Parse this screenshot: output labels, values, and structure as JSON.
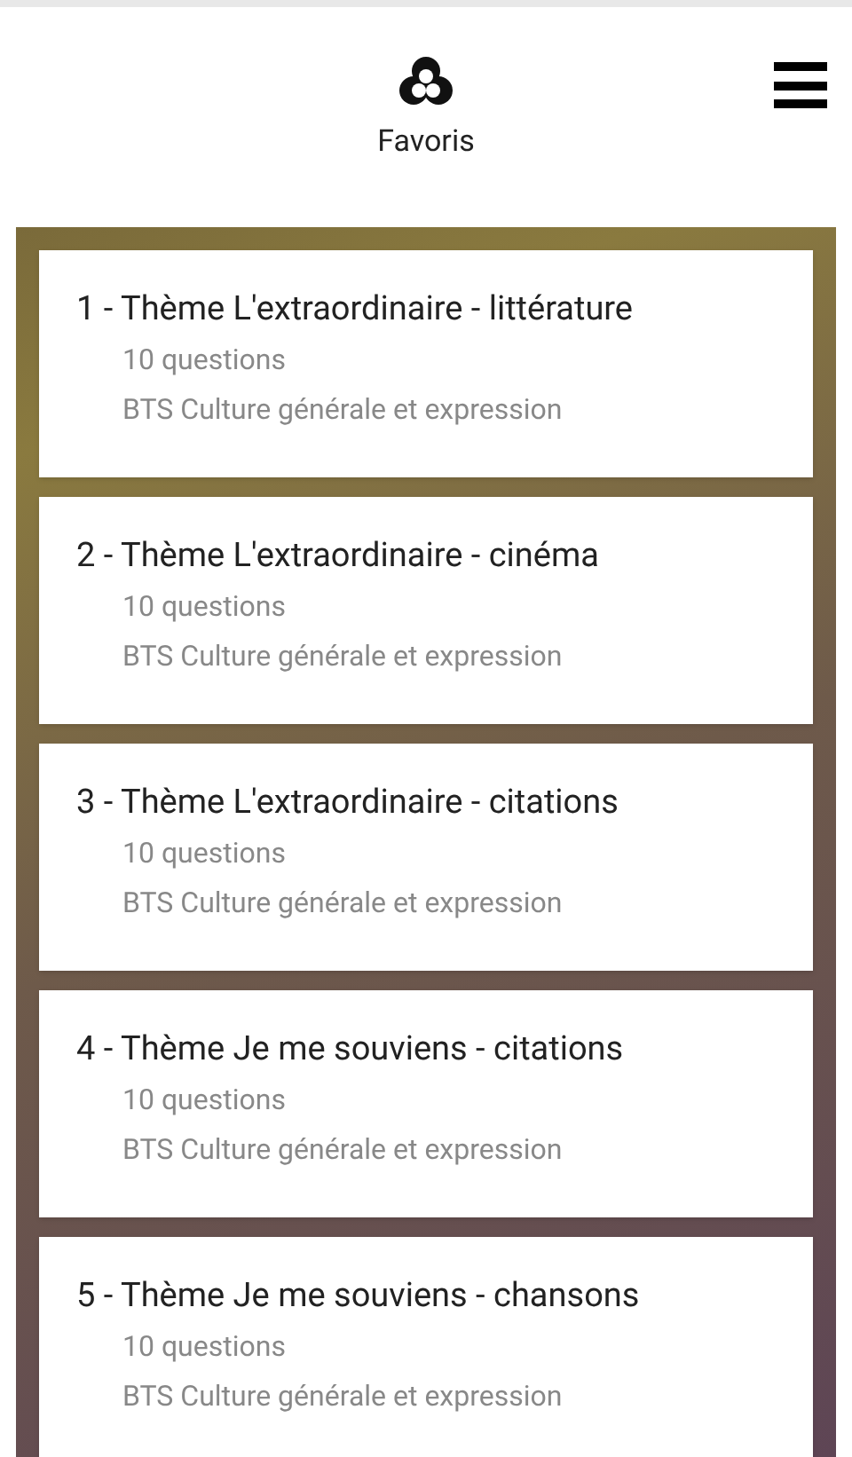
{
  "header": {
    "title": "Favoris"
  },
  "quizzes": [
    {
      "title": "1 - Thème L'extraordinaire - littérature",
      "count": "10 questions",
      "subject": "BTS Culture générale et expression"
    },
    {
      "title": "2 - Thème L'extraordinaire - cinéma",
      "count": "10 questions",
      "subject": "BTS Culture générale et expression"
    },
    {
      "title": "3 - Thème L'extraordinaire - citations",
      "count": "10 questions",
      "subject": "BTS Culture générale et expression"
    },
    {
      "title": "4 - Thème Je me souviens - citations",
      "count": "10 questions",
      "subject": "BTS Culture générale et expression"
    },
    {
      "title": "5 - Thème Je me souviens - chansons",
      "count": "10 questions",
      "subject": "BTS Culture générale et expression"
    }
  ]
}
